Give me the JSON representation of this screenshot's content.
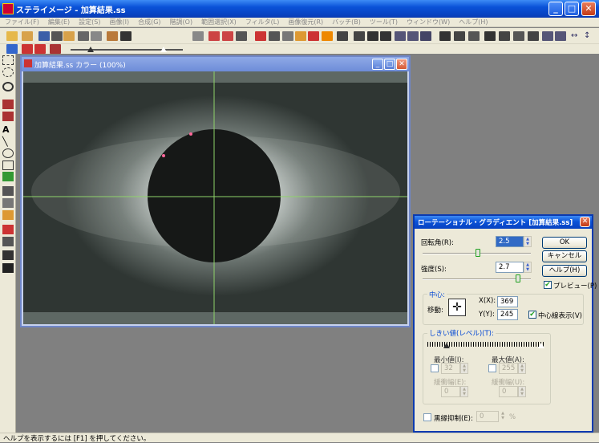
{
  "app": {
    "title": "ステライメージ - 加算結果.ss",
    "min": "_",
    "max": "□",
    "close": "✕"
  },
  "menu": [
    "ファイル(F)",
    "編集(E)",
    "設定(S)",
    "画像(I)",
    "合成(G)",
    "階調(O)",
    "範囲選択(X)",
    "フィルタ(L)",
    "画像復元(R)",
    "バッチ(B)",
    "ツール(T)",
    "ウィンドウ(W)",
    "ヘルプ(H)"
  ],
  "image_window": {
    "title": "加算結果.ss カラー (100%)"
  },
  "dialog": {
    "title": "ローテーショナル・グラディエント [加算結果.ss]",
    "rotation_label": "回転角(R):",
    "rotation_value": "2.5",
    "strength_label": "強度(S):",
    "strength_value": "2.7",
    "ok": "OK",
    "cancel": "キャンセル",
    "help": "ヘルプ(H)",
    "preview_label": "プレビュー(P)",
    "preview_checked": true,
    "center_group": "中心:",
    "move_label": "移動:",
    "x_label": "X(X):",
    "x_value": "369",
    "y_label": "Y(Y):",
    "y_value": "245",
    "show_center_label": "中心線表示(V)",
    "show_center_checked": true,
    "threshold_group": "しきい値(レベル)(T):",
    "min_label": "最小値(I):",
    "min_value": "32",
    "max_label": "最大値(A):",
    "max_value": "255",
    "min_slope_label": "緩衝幅(E):",
    "min_slope_value": "0",
    "max_slope_label": "緩衝幅(U):",
    "max_slope_value": "0",
    "edge_label": "黒縁抑制(E):",
    "edge_value": "0",
    "edge_unit": "%"
  },
  "status": {
    "text": "ヘルプを表示するには [F1] を押してください。"
  },
  "colors": {
    "titlebar": "#0a52d8",
    "crosshair": "#8fd36a",
    "face": "#ece9d8"
  }
}
